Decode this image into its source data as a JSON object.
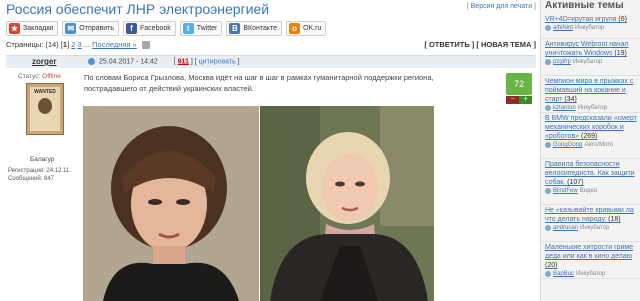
{
  "header": {
    "title": "Россия обеспечит ЛНР электроэнергией",
    "print_prefix": "[ ",
    "print_link": "Версия для печати",
    "print_suffix": " ]"
  },
  "share": [
    {
      "icon": "bookmark-icon",
      "label": "Закладки",
      "color": "#d34836"
    },
    {
      "icon": "send-icon",
      "label": "Отправить",
      "color": "#4c8fce"
    },
    {
      "icon": "facebook-icon",
      "label": "Facebook",
      "color": "#3b5998"
    },
    {
      "icon": "twitter-icon",
      "label": "Twitter",
      "color": "#55acee"
    },
    {
      "icon": "vkontakte-icon",
      "label": "ВКонтакте",
      "color": "#4a76a8"
    },
    {
      "icon": "odnoklassniki-icon",
      "label": "OK.ru",
      "color": "#ee8208"
    }
  ],
  "pager": {
    "prefix": "Страницы: (14) [",
    "current": "1",
    "bracket": "]",
    "p2": "2",
    "p3": "3",
    "ellipsis": "...",
    "last": "Последняя »",
    "reply": "[ ОТВЕТИТЬ ]",
    "new_topic": "[ НОВАЯ ТЕМА ]"
  },
  "post": {
    "author": "zorger",
    "date": "25.04.2017 - 14:42",
    "number_prefix": "[ ",
    "number": "911",
    "number_mid": " ] [ ",
    "quote_link": "цитировать",
    "quote_suffix": " ]",
    "text": "По словам Бориса Грызлова, Москва идёт на шаг в шаг в рамках гуманитарной поддержки региона, пострадавшего от действий украинских властей.",
    "rating": "72",
    "minus": "−",
    "plus": "+"
  },
  "user": {
    "status_label": "Статус:",
    "status_value": "Offline",
    "avatar_text": "WANTED",
    "rank": "Балагур",
    "registered": "Регистрация: 24.12.11",
    "messages": "Сообщений: 847"
  },
  "sidebar": {
    "title": "Активные темы",
    "items": [
      {
        "link": "VR+4D=крутая игруля",
        "count": " (6)",
        "user": "alhiNint",
        "section": "Инкубатор",
        "rows": 1
      },
      {
        "link": "Антивирус Webroot начал уничтожать Windows",
        "count": " (19)",
        "user": "pzgifrp",
        "section": "Инкубатор",
        "rows": 2
      },
      {
        "link": "Чемпион мира в прыжках с поймавший на кокание и старт",
        "count": " (34)",
        "user": "kztanton",
        "section": "Инкубатор",
        "rows": 2
      },
      {
        "link": "В BMW предсказали «смерт механических коробок и «роботов»",
        "count": " (269)",
        "user": "GongGong",
        "section": "Авто/Мото",
        "rows": 3
      },
      {
        "link": "Правила безопасности велосипедиста. Как защити собак.",
        "count": " (107)",
        "user": "BlindFew",
        "section": "Видео",
        "rows": 3
      },
      {
        "link": "Не «казывайте кривыми ла что делать народу.",
        "count": " (18)",
        "user": "andrucan",
        "section": "Инкубатор",
        "rows": 2
      },
      {
        "link": "Маленькие хитрости гриме деда или как в кино делаю",
        "count": " (20)",
        "user": "BapBuc",
        "section": "Инкубатор",
        "rows": 2
      }
    ]
  }
}
